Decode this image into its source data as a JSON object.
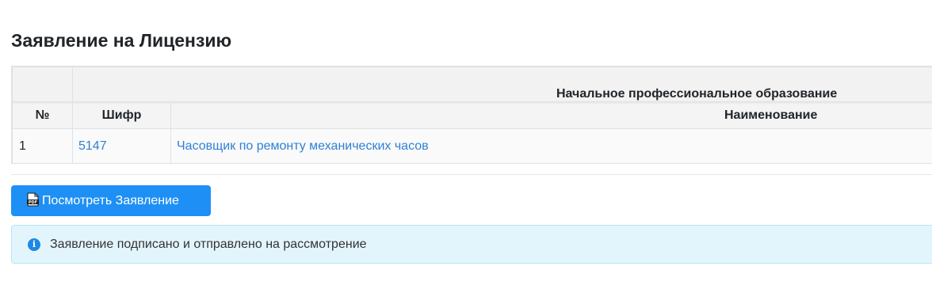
{
  "page": {
    "title": "Заявление на Лицензию"
  },
  "table": {
    "group_header": "Начальное профессиональное образование",
    "columns": {
      "num": "№",
      "code": "Шифр",
      "name": "Наименование"
    },
    "rows": [
      {
        "num": "1",
        "code": "5147",
        "name": "Часовщик по ремонту механических часов"
      }
    ]
  },
  "actions": {
    "view_button_label": "Посмотреть Заявление",
    "view_button_icon": "pdf-icon"
  },
  "alert": {
    "icon": "info-icon",
    "text": "Заявление подписано и отправлено на рассмотрение",
    "color": "#e3f5fc"
  },
  "colors": {
    "accent": "#1e90f5",
    "link": "#2f80d5"
  }
}
